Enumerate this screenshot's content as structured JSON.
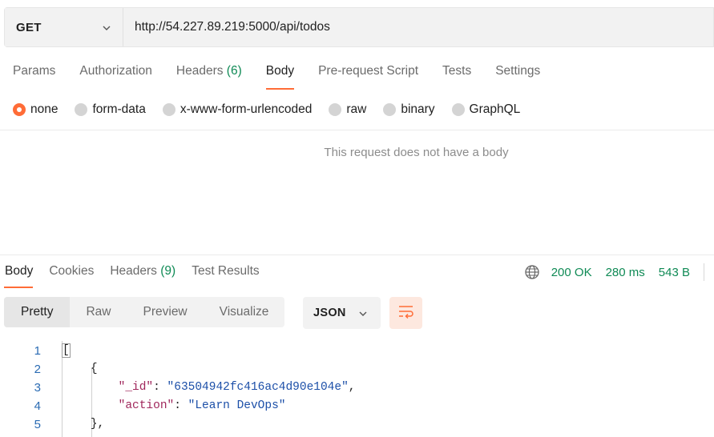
{
  "request": {
    "method": "GET",
    "url": "http://54.227.89.219:5000/api/todos",
    "tabs": [
      {
        "label": "Params",
        "count": ""
      },
      {
        "label": "Authorization",
        "count": ""
      },
      {
        "label": "Headers",
        "count": "(6)"
      },
      {
        "label": "Body",
        "count": ""
      },
      {
        "label": "Pre-request Script",
        "count": ""
      },
      {
        "label": "Tests",
        "count": ""
      },
      {
        "label": "Settings",
        "count": ""
      }
    ],
    "active_tab": "Body",
    "body_types": [
      "none",
      "form-data",
      "x-www-form-urlencoded",
      "raw",
      "binary",
      "GraphQL"
    ],
    "selected_body_type": "none",
    "empty_body_message": "This request does not have a body"
  },
  "response": {
    "tabs": [
      {
        "label": "Body",
        "count": ""
      },
      {
        "label": "Cookies",
        "count": ""
      },
      {
        "label": "Headers",
        "count": "(9)"
      },
      {
        "label": "Test Results",
        "count": ""
      }
    ],
    "active_tab": "Body",
    "status": "200 OK",
    "time": "280 ms",
    "size": "543 B",
    "views": [
      "Pretty",
      "Raw",
      "Preview",
      "Visualize"
    ],
    "active_view": "Pretty",
    "format": "JSON",
    "code_lines": [
      {
        "num": "1",
        "indent": "",
        "parts": [
          {
            "t": "[",
            "c": "bracket"
          }
        ]
      },
      {
        "num": "2",
        "indent": "    ",
        "parts": [
          {
            "t": "{",
            "c": "plain"
          }
        ]
      },
      {
        "num": "3",
        "indent": "        ",
        "parts": [
          {
            "t": "\"_id\"",
            "c": "key"
          },
          {
            "t": ": ",
            "c": "plain"
          },
          {
            "t": "\"63504942fc416ac4d90e104e\"",
            "c": "str"
          },
          {
            "t": ",",
            "c": "plain"
          }
        ]
      },
      {
        "num": "4",
        "indent": "        ",
        "parts": [
          {
            "t": "\"action\"",
            "c": "key"
          },
          {
            "t": ": ",
            "c": "plain"
          },
          {
            "t": "\"Learn DevOps\"",
            "c": "str"
          }
        ]
      },
      {
        "num": "5",
        "indent": "    ",
        "parts": [
          {
            "t": "},",
            "c": "plain"
          }
        ]
      }
    ]
  },
  "colors": {
    "accent": "#ff6c37",
    "success": "#0f8a55"
  },
  "icons": [
    "chevron-down-icon",
    "globe-icon",
    "wrap-lines-icon"
  ]
}
